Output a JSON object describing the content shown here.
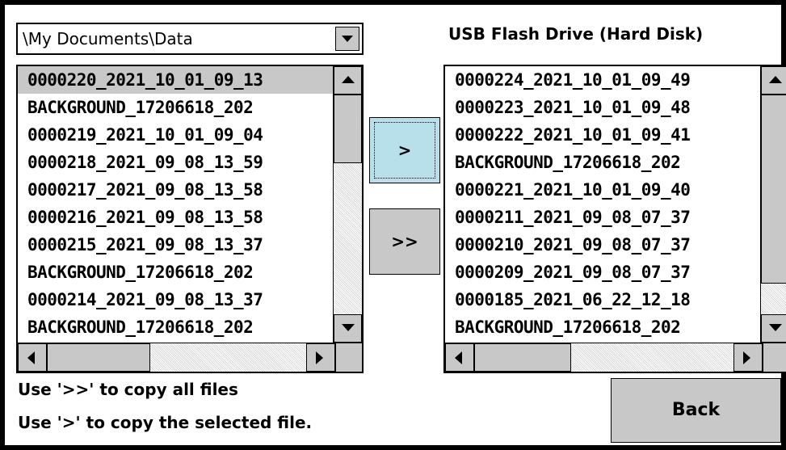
{
  "source": {
    "path_value": "\\My Documents\\Data",
    "files": [
      "0000220_2021_10_01_09_13",
      "BACKGROUND_17206618_202",
      "0000219_2021_10_01_09_04",
      "0000218_2021_09_08_13_59",
      "0000217_2021_09_08_13_58",
      "0000216_2021_09_08_13_58",
      "0000215_2021_09_08_13_37",
      "BACKGROUND_17206618_202",
      "0000214_2021_09_08_13_37",
      "BACKGROUND_17206618_202"
    ],
    "selected_index": 0
  },
  "target": {
    "label": "USB Flash Drive (Hard Disk)",
    "files": [
      "0000224_2021_10_01_09_49",
      "0000223_2021_10_01_09_48",
      "0000222_2021_10_01_09_41",
      "BACKGROUND_17206618_202",
      "0000221_2021_10_01_09_40",
      "0000211_2021_09_08_07_37",
      "0000210_2021_09_08_07_37",
      "0000209_2021_09_08_07_37",
      "0000185_2021_06_22_12_18",
      "BACKGROUND_17206618_202"
    ]
  },
  "actions": {
    "copy_selected_label": ">",
    "copy_all_label": ">>",
    "back_label": "Back"
  },
  "hints": {
    "copy_all": "Use '>>' to copy all files",
    "copy_selected": "Use '>' to copy the selected file."
  },
  "icons": {
    "dropdown": "chevron-down-icon",
    "scroll_up": "arrow-up-icon",
    "scroll_down": "arrow-down-icon",
    "scroll_left": "arrow-left-icon",
    "scroll_right": "arrow-right-icon"
  },
  "colors": {
    "selected_row": "#c8c8c8",
    "focused_button": "#b8e0ea",
    "button_face": "#c8c8c8"
  }
}
